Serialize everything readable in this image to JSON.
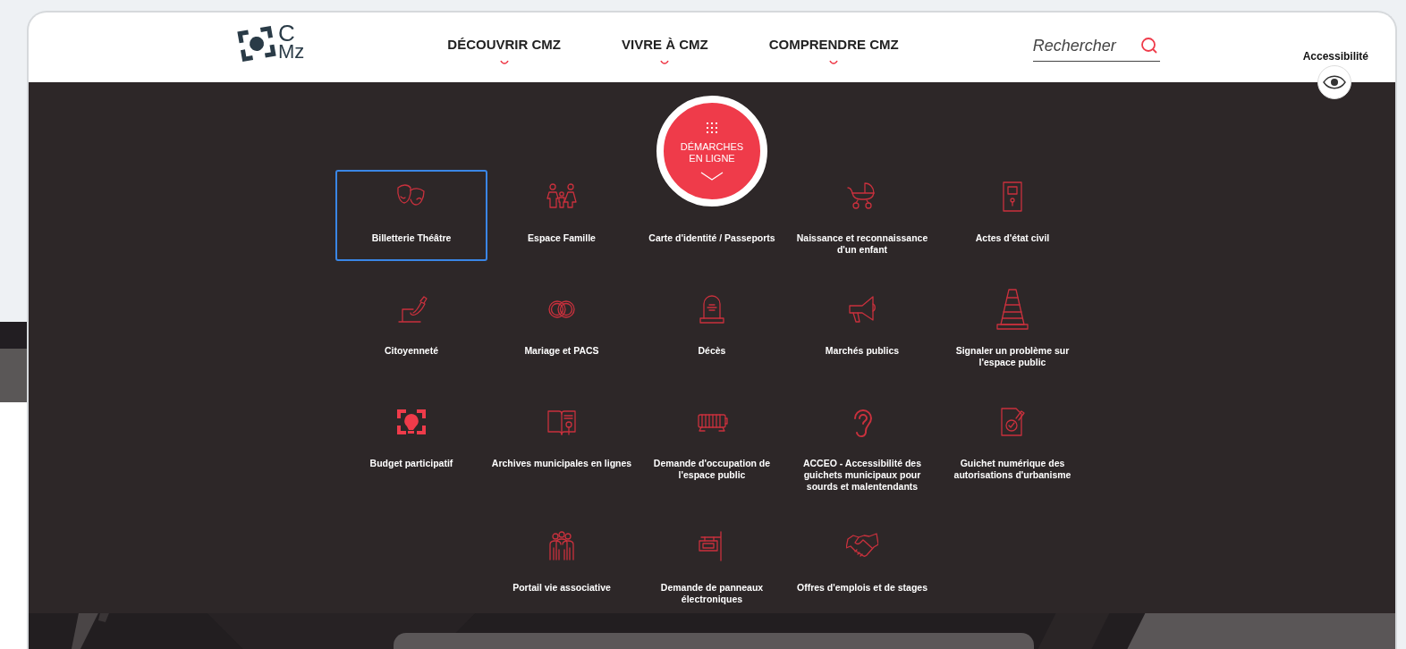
{
  "logo": {
    "line_1": "C",
    "line_2": "Mz"
  },
  "nav": [
    {
      "label": "DÉCOUVRIR CMZ"
    },
    {
      "label": "VIVRE À CMZ"
    },
    {
      "label": "COMPRENDRE CMZ"
    }
  ],
  "search": {
    "placeholder": "Rechercher"
  },
  "accessibility": {
    "label": "Accessibilité"
  },
  "online_button": {
    "label": "DÉMARCHES EN LIGNE"
  },
  "service_rows": [
    {
      "items": [
        {
          "label": "Billetterie Théâtre",
          "selected": true
        },
        {
          "label": "Espace Famille",
          "selected": false
        },
        {
          "label": "Carte d'identité / Passeports",
          "selected": false
        },
        {
          "label": "Naissance et reconnaissance d'un enfant",
          "selected": false
        },
        {
          "label": "Actes d'état civil",
          "selected": false
        }
      ]
    },
    {
      "items": [
        {
          "label": "Citoyenneté",
          "selected": false
        },
        {
          "label": "Mariage et PACS",
          "selected": false
        },
        {
          "label": "Décès",
          "selected": false
        },
        {
          "label": "Marchés publics",
          "selected": false
        },
        {
          "label": "Signaler un problème sur l'espace public",
          "selected": false
        }
      ]
    },
    {
      "items": [
        {
          "label": "Budget participatif",
          "selected": false
        },
        {
          "label": "Archives municipales en lignes",
          "selected": false
        },
        {
          "label": "Demande d'occupation de l'espace public",
          "selected": false
        },
        {
          "label": "ACCEO - Accessibilité des guichets municipaux pour sourds et malentendants",
          "selected": false
        },
        {
          "label": "Guichet numérique des autorisations d'urbanisme",
          "selected": false
        }
      ]
    },
    {
      "items": [
        {
          "label": "Portail vie associative",
          "selected": false
        },
        {
          "label": "Demande de panneaux électroniques",
          "selected": false
        },
        {
          "label": "Offres d'emplois et de stages",
          "selected": false
        }
      ]
    }
  ]
}
